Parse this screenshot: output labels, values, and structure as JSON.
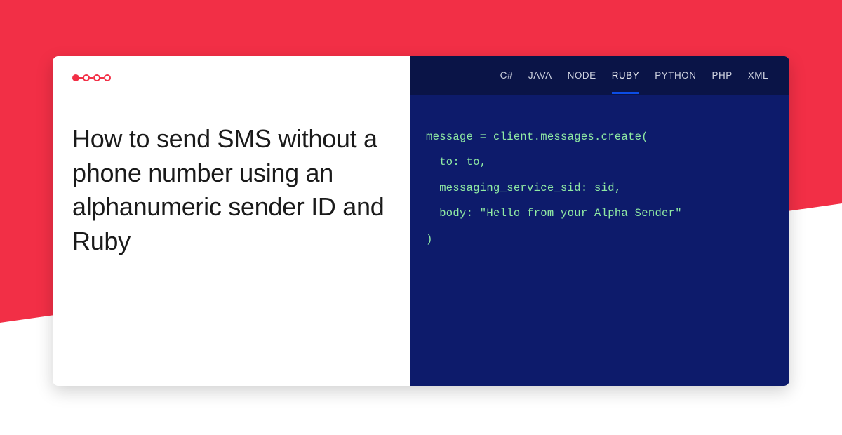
{
  "headline": "How to send SMS without a phone number using an alphanumeric sender ID and Ruby",
  "tabs": {
    "csharp": "C#",
    "java": "JAVA",
    "node": "NODE",
    "ruby": "RUBY",
    "python": "PYTHON",
    "php": "PHP",
    "xml": "XML"
  },
  "active_tab": "ruby",
  "code": "message = client.messages.create(\n  to: to,\n  messaging_service_sid: sid,\n  body: \"Hello from your Alpha Sender\"\n)"
}
